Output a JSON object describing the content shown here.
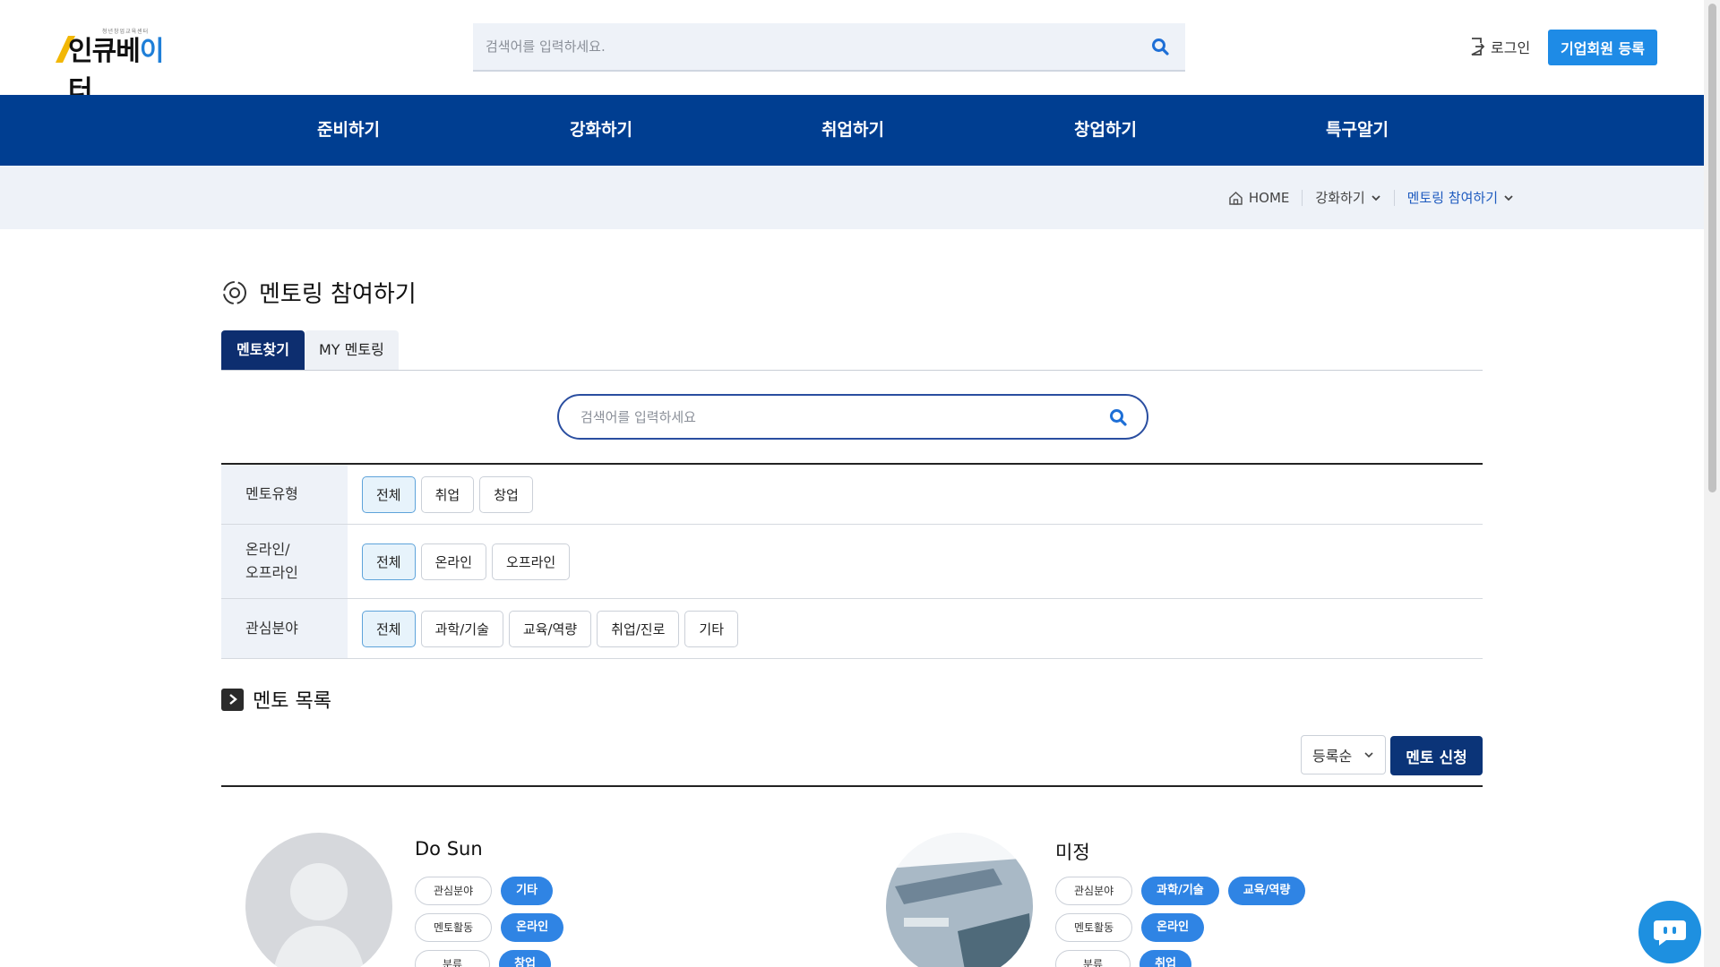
{
  "header": {
    "logo_text_a": "인큐베",
    "logo_text_b": "이",
    "logo_text_c": "터",
    "logo_tagline": "청년창업교육센터",
    "search_placeholder": "검색어를 입력하세요.",
    "login_label": "로그인",
    "corp_register_label": "기업회원 등록"
  },
  "nav": {
    "items": [
      "준비하기",
      "강화하기",
      "취업하기",
      "창업하기",
      "특구알기"
    ]
  },
  "breadcrumb": {
    "home": "HOME",
    "level1": "강화하기",
    "level2": "멘토링 참여하기"
  },
  "page": {
    "title": "멘토링 참여하기",
    "tabs": [
      {
        "label": "멘토찾기",
        "active": true
      },
      {
        "label": "MY 멘토링",
        "active": false
      }
    ],
    "search_placeholder": "검색어를 입력하세요"
  },
  "filters": [
    {
      "label": "멘토유형",
      "options": [
        "전체",
        "취업",
        "창업"
      ],
      "selected": "전체"
    },
    {
      "label": "온라인/\n오프라인",
      "options": [
        "전체",
        "온라인",
        "오프라인"
      ],
      "selected": "전체"
    },
    {
      "label": "관심분야",
      "options": [
        "전체",
        "과학/기술",
        "교육/역량",
        "취업/진로",
        "기타"
      ],
      "selected": "전체"
    }
  ],
  "list": {
    "title": "멘토 목록",
    "sort_value": "등록순",
    "apply_label": "멘토 신청"
  },
  "mentors": [
    {
      "name": "Do Sun",
      "rows": [
        {
          "label": "관심분야",
          "values": [
            "기타"
          ]
        },
        {
          "label": "멘토활동",
          "values": [
            "온라인"
          ]
        },
        {
          "label": "분류",
          "values": [
            "창업"
          ]
        }
      ]
    },
    {
      "name": "미정",
      "rows": [
        {
          "label": "관심분야",
          "values": [
            "과학/기술",
            "교육/역량"
          ]
        },
        {
          "label": "멘토활동",
          "values": [
            "온라인"
          ]
        },
        {
          "label": "분류",
          "values": [
            "취업"
          ]
        }
      ]
    }
  ],
  "colors": {
    "nav_bg": "#003e91",
    "accent": "#1e8be6",
    "tag_blue": "#2f84e4",
    "dark_navy": "#0b3478"
  }
}
